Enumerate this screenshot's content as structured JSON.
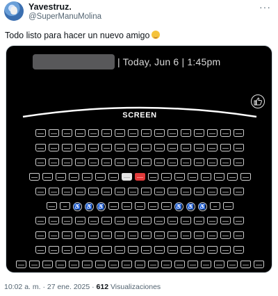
{
  "author": {
    "display_name": "Yavestruz.",
    "handle": "@SuperManuMolina",
    "avatar_icon": "avatar-image"
  },
  "more_label": "···",
  "tweet": {
    "text": "Todo listo para hacer un nuevo amigo",
    "emoji": "hugging-face-emoji"
  },
  "media": {
    "showtime": "| Today, Jun 6 | 1:45pm",
    "screen_label": "SCREEN",
    "like_icon": "thumbs-up-icon",
    "colors": {
      "background": "#000000",
      "seat_outline": "#cfcfcf",
      "seat_selected": "#e3e3e3",
      "seat_taken": "#e03a3a"
    },
    "rows": [
      {
        "seats": "SSSSSSSSSSSSSSSS"
      },
      {
        "seats": "SSSSSSSSSSSSSSSS"
      },
      {
        "seats": "SSSSSSSSSSSSSSSS"
      },
      {
        "seats": "SSSSSSSMRSSSSSSSS"
      },
      {
        "seats": "SSSSSSSSSSSSSSSS"
      },
      {
        "seats": "SCWWWSSSSSWWWCS"
      },
      {
        "seats": "SSSSSSSSSSSSSSSS"
      },
      {
        "seats": "SSSSSSSSSSSSSSSS"
      },
      {
        "seats": "SSSSSSSSSSSSSSSS"
      },
      {
        "seats": "SSSSSSSSSSSSSSSSSSS"
      }
    ]
  },
  "meta": {
    "time": "10:02 a. m.",
    "sep": "·",
    "date": "27 ene. 2025",
    "views_count": "612",
    "views_label": "Visualizaciones"
  }
}
